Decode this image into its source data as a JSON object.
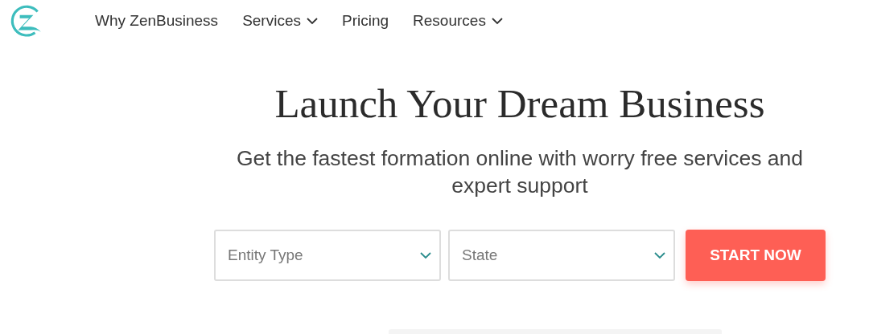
{
  "nav": {
    "items": [
      {
        "label": "Why ZenBusiness",
        "kind": "link"
      },
      {
        "label": "Services",
        "kind": "menu"
      },
      {
        "label": "Pricing",
        "kind": "link"
      },
      {
        "label": "Resources",
        "kind": "menu"
      }
    ]
  },
  "hero": {
    "title": "Launch Your Dream Business",
    "subtitle": "Get the fastest formation online with worry free services and expert support"
  },
  "form": {
    "selects": [
      {
        "placeholder": "Entity Type"
      },
      {
        "placeholder": "State"
      }
    ],
    "button": "START NOW"
  }
}
